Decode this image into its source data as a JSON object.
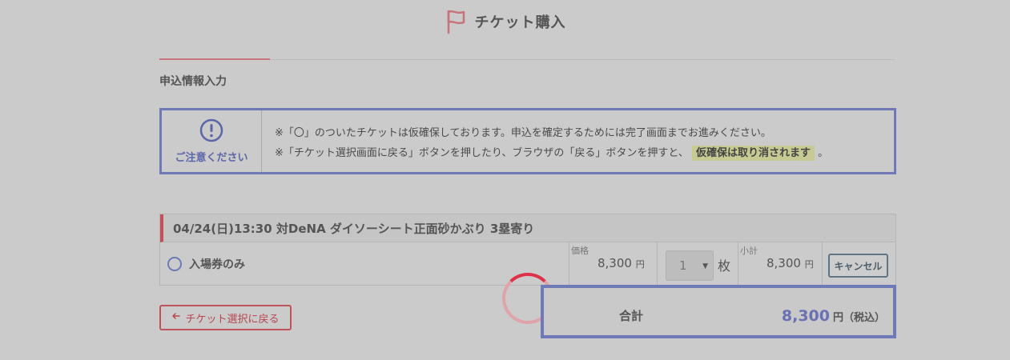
{
  "header": {
    "title": "チケット購入"
  },
  "section": {
    "title": "申込情報入力"
  },
  "notice": {
    "label": "ご注意ください",
    "line1": "※「〇」のついたチケットは仮確保しております。申込を確定するためには完了画面までお進みください。",
    "line2_prefix": "※「チケット選択画面に戻る」ボタンを押したり、ブラウザの「戻る」ボタンを押すと、",
    "line2_highlight": "仮確保は取り消されます",
    "line2_suffix": "。"
  },
  "ticket": {
    "heading": "04/24(日)13:30 対DeNA ダイソーシート正面砂かぶり 3塁寄り",
    "name": "入場券のみ",
    "price_label": "価格",
    "price": "8,300",
    "price_unit": "円",
    "quantity": "1",
    "quantity_unit": "枚",
    "subtotal_label": "小計",
    "subtotal": "8,300",
    "subtotal_unit": "円",
    "cancel_label": "キャンセル"
  },
  "back_button": {
    "label": "チケット選択に戻る"
  },
  "total": {
    "label": "合計",
    "value": "8,300",
    "unit": "円（税込）"
  },
  "colors": {
    "accent": "#6f79b8",
    "brand_red": "#c0525b",
    "highlight": "#c7cb93",
    "spinner": "#e0314a"
  },
  "icons": {
    "header": "flag-icon",
    "notice": "exclamation-circle-icon",
    "back": "arrow-left-icon"
  }
}
